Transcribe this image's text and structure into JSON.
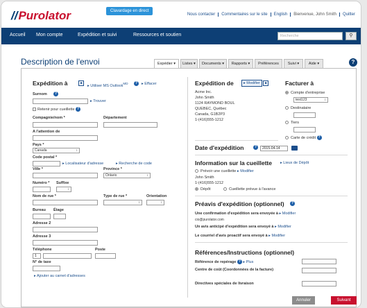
{
  "brand": {
    "logo": "Purolator"
  },
  "header": {
    "chat": "Clavardage en direct",
    "links": [
      "Nous contacter",
      "Commentaires sur le site",
      "English",
      "Bienvenue, John Smith",
      "Quitter"
    ]
  },
  "nav": {
    "items": [
      "Accueil",
      "Mon compte",
      "Expédition et suivi",
      "Ressources et soutien"
    ],
    "search_placeholder": "Recherche",
    "search_icon": "search-icon"
  },
  "page": {
    "title": "Description de l'envoi"
  },
  "tabs": [
    "Expédier",
    "Listes",
    "Documents",
    "Rapports",
    "Préférences",
    "Suivi",
    "Aide"
  ],
  "ship_to": {
    "heading": "Expédition à",
    "outlook": "Utiliser MS Outlook",
    "outlook_sup": "MD",
    "clear": "Effacer",
    "surnom": "Surnom",
    "trouver": "Trouver",
    "retenir": "Retenir pour cueillette",
    "company": "Compagnie/nom",
    "dept": "Département",
    "attention": "A l'attention de",
    "pays": "Pays",
    "pays_val": "Canada",
    "code": "Code postal",
    "loc": "Localisateur d'adresse",
    "rech": "Recherche de code",
    "ville": "Ville",
    "province": "Province",
    "province_val": "Ontario",
    "numero": "Numéro",
    "suffixe": "Suffixe",
    "rue": "Nom de rue",
    "type_rue": "Type de rue",
    "orientation": "Orientation",
    "bureau": "Bureau",
    "etage": "Étage",
    "adr2": "Adresse 2",
    "adr3": "Adresse 3",
    "tel": "Téléphone",
    "poste": "Poste",
    "tel_val": "1",
    "taxe": "N° de taxe",
    "carnet": "Ajouter au carnet d'adresses"
  },
  "ship_from": {
    "heading": "Expédition de",
    "modifier": "Modifier",
    "lines": [
      "Acme Inc.",
      "John Smith",
      "1124 RAYMOND BOUL",
      "QUEBEC, Québec",
      "Canada, G1B2P3",
      "1-(416)555-1212"
    ]
  },
  "bill": {
    "heading": "Facturer à",
    "options": [
      "Compte d'entreprise",
      "Destinataire",
      "Tiers",
      "Carte de crédit"
    ],
    "account": "test123"
  },
  "date": {
    "heading": "Date d'expédition",
    "value": "2015-04-14"
  },
  "pickup": {
    "heading": "Information sur la cueillette",
    "lieux": "Lieux de Dépôt",
    "prevoir": "Prévoir une cueillette",
    "modifier": "Modifier",
    "name": "John Smith",
    "phone": "1-(416)555-1212",
    "depot": "Dépôt",
    "prevue": "Cueillette prévue à l'avance"
  },
  "notice": {
    "heading": "Préavis d'expédition (optionnel)",
    "line1": "Une confirmation d'expédition sera envoyée à",
    "email": "cio@purolator.com",
    "line2": "Un avis anticipé d'expédition sera envoyé à",
    "line3": "Le courriel d'avis proactif sera envoyé à",
    "modifier": "Modifier"
  },
  "refs": {
    "heading": "Références/Instructions (optionnel)",
    "ref": "Référence de repérage",
    "plus": "Plus",
    "centre": "Centre de coût (Coordonnées de la facture)",
    "dir": "Directives spéciales de livraison"
  },
  "actions": {
    "cancel": "Annuler",
    "next": "Suivant"
  }
}
